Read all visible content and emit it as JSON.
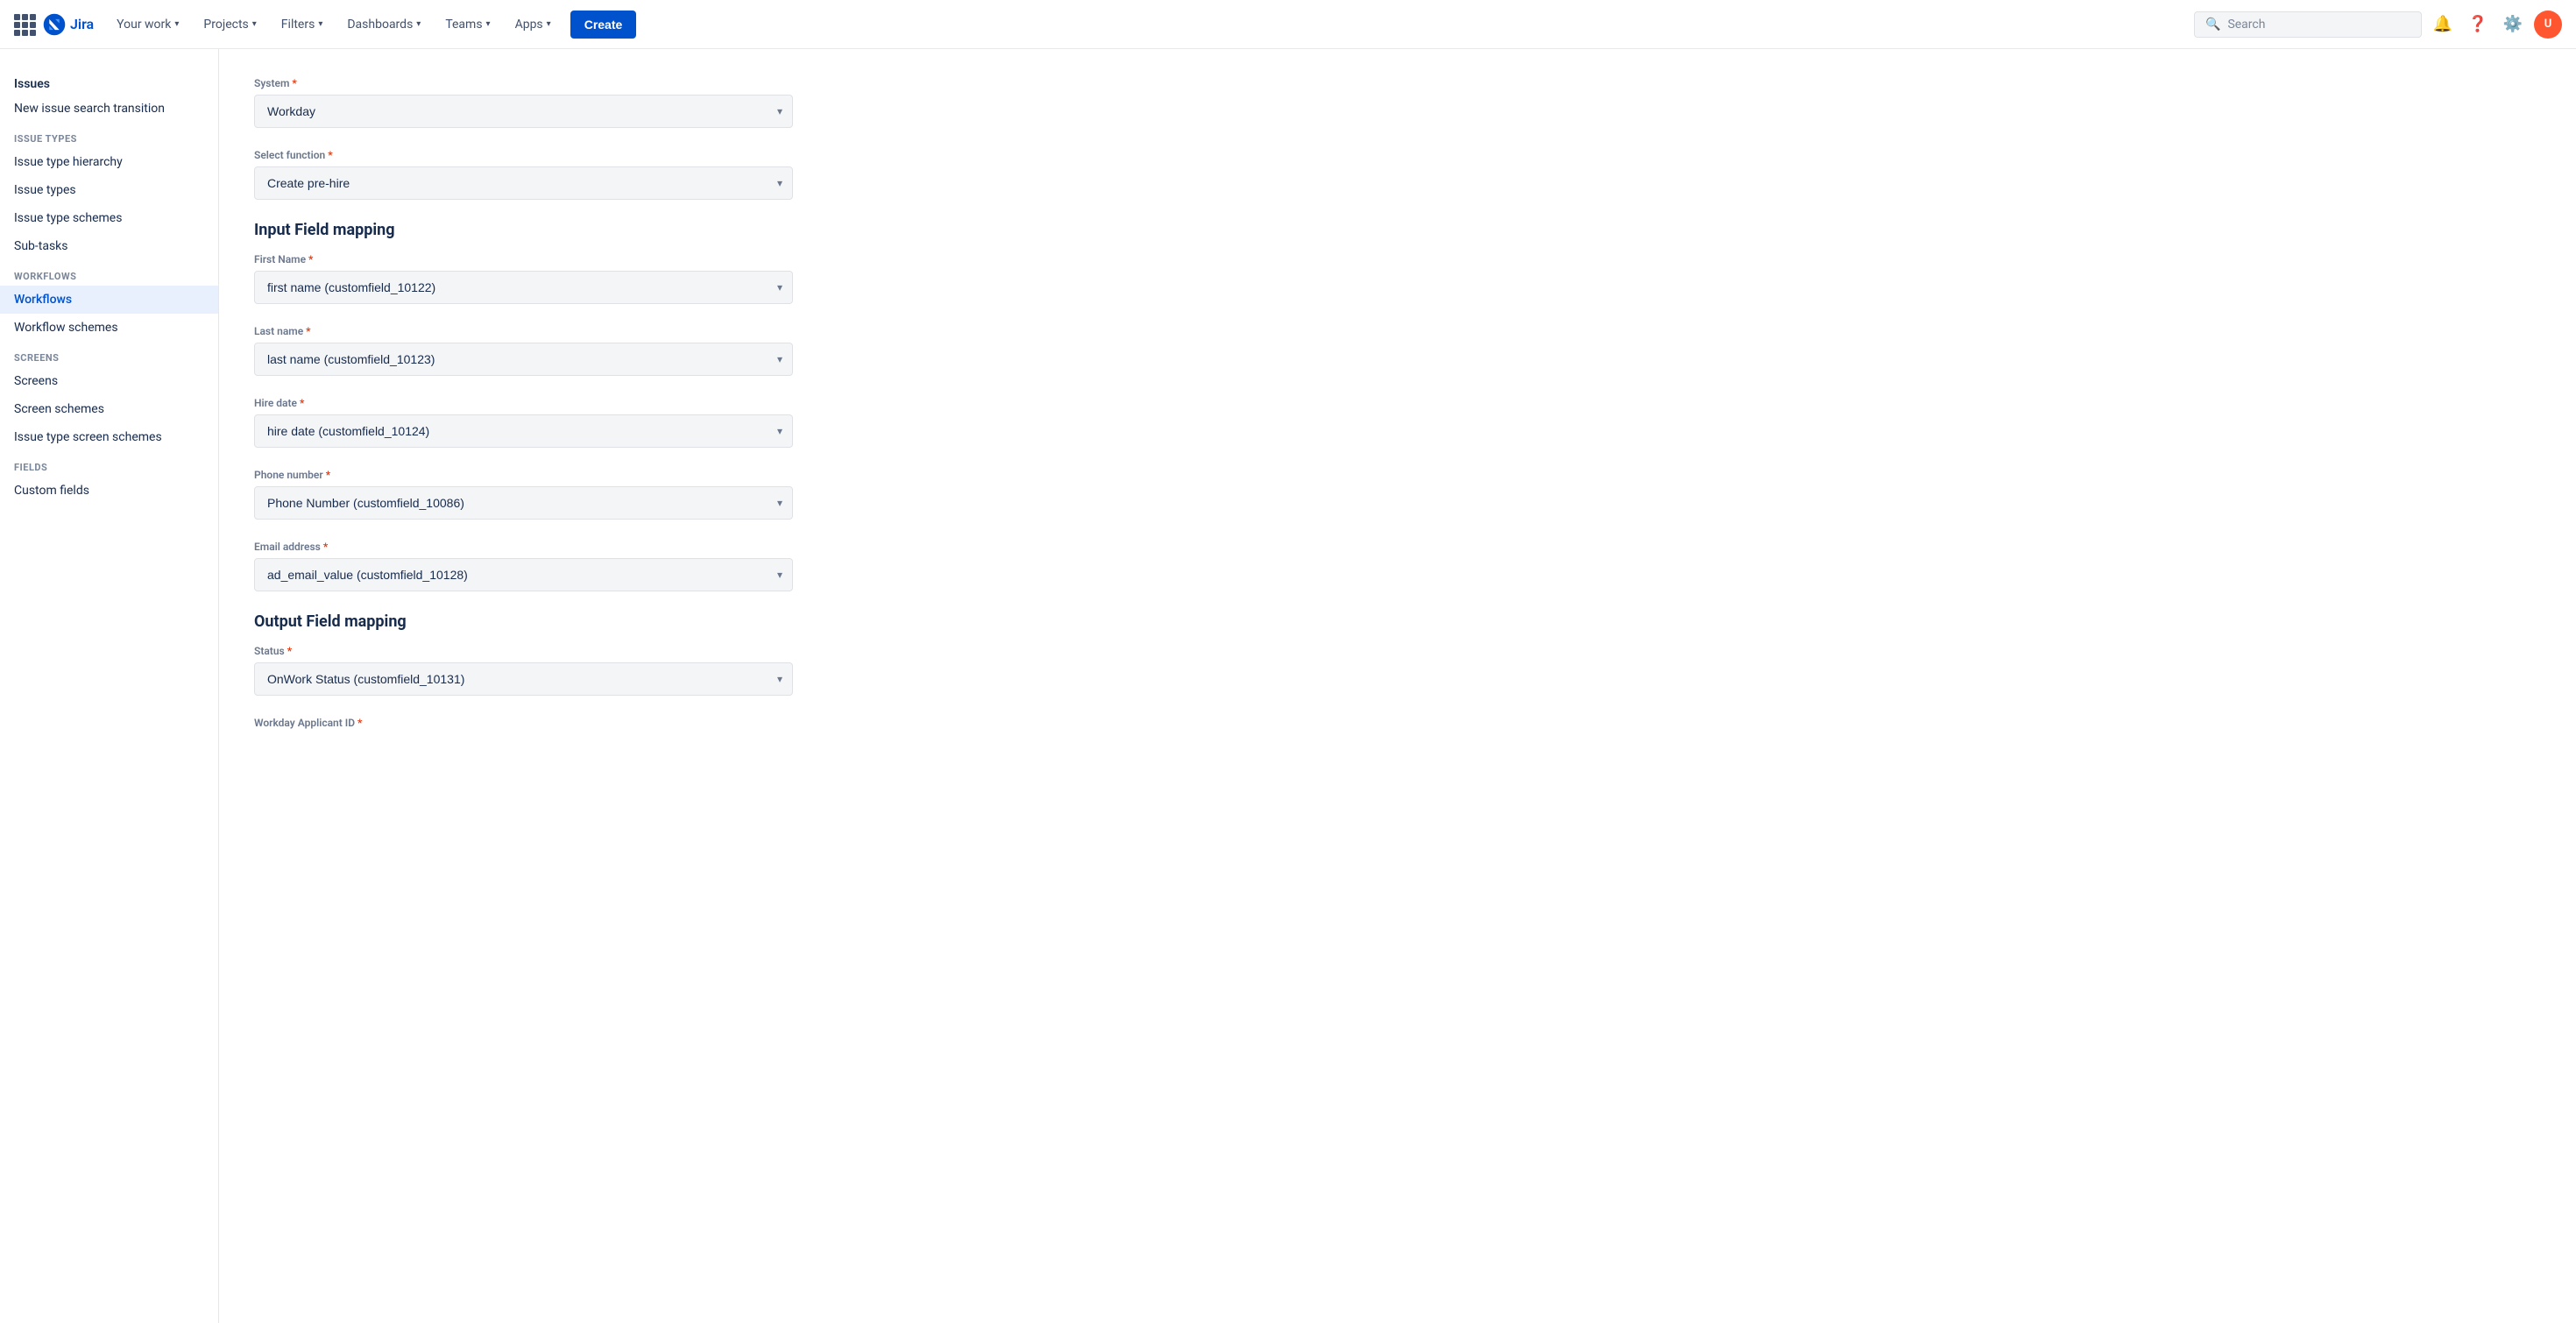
{
  "topnav": {
    "logo_text": "Jira",
    "nav_items": [
      {
        "label": "Your work",
        "has_chevron": true
      },
      {
        "label": "Projects",
        "has_chevron": true
      },
      {
        "label": "Filters",
        "has_chevron": true
      },
      {
        "label": "Dashboards",
        "has_chevron": true
      },
      {
        "label": "Teams",
        "has_chevron": true
      },
      {
        "label": "Apps",
        "has_chevron": true
      }
    ],
    "create_label": "Create",
    "search_placeholder": "Search"
  },
  "sidebar": {
    "heading": "Issues",
    "items": [
      {
        "label": "New issue search transition",
        "section": null,
        "active": false
      },
      {
        "label": "ISSUE TYPES",
        "section": true
      },
      {
        "label": "Issue type hierarchy",
        "active": false
      },
      {
        "label": "Issue types",
        "active": false
      },
      {
        "label": "Issue type schemes",
        "active": false
      },
      {
        "label": "Sub-tasks",
        "active": false
      },
      {
        "label": "WORKFLOWS",
        "section": true
      },
      {
        "label": "Workflows",
        "active": true
      },
      {
        "label": "Workflow schemes",
        "active": false
      },
      {
        "label": "SCREENS",
        "section": true
      },
      {
        "label": "Screens",
        "active": false
      },
      {
        "label": "Screen schemes",
        "active": false
      },
      {
        "label": "Issue type screen schemes",
        "active": false
      },
      {
        "label": "FIELDS",
        "section": true
      },
      {
        "label": "Custom fields",
        "active": false
      }
    ]
  },
  "form": {
    "system_label": "System",
    "system_value": "Workday",
    "select_function_label": "Select function",
    "select_function_value": "Create pre-hire",
    "input_field_mapping_heading": "Input Field mapping",
    "fields": [
      {
        "label": "First Name",
        "value": "first name (customfield_10122)"
      },
      {
        "label": "Last name",
        "value": "last name (customfield_10123)"
      },
      {
        "label": "Hire date",
        "value": "hire date (customfield_10124)"
      },
      {
        "label": "Phone number",
        "value": "Phone Number (customfield_10086)"
      },
      {
        "label": "Email address",
        "value": "ad_email_value (customfield_10128)"
      }
    ],
    "output_field_mapping_heading": "Output Field mapping",
    "output_fields": [
      {
        "label": "Status",
        "value": "OnWork Status (customfield_10131)"
      },
      {
        "label": "Workday Applicant ID",
        "value": ""
      }
    ]
  }
}
